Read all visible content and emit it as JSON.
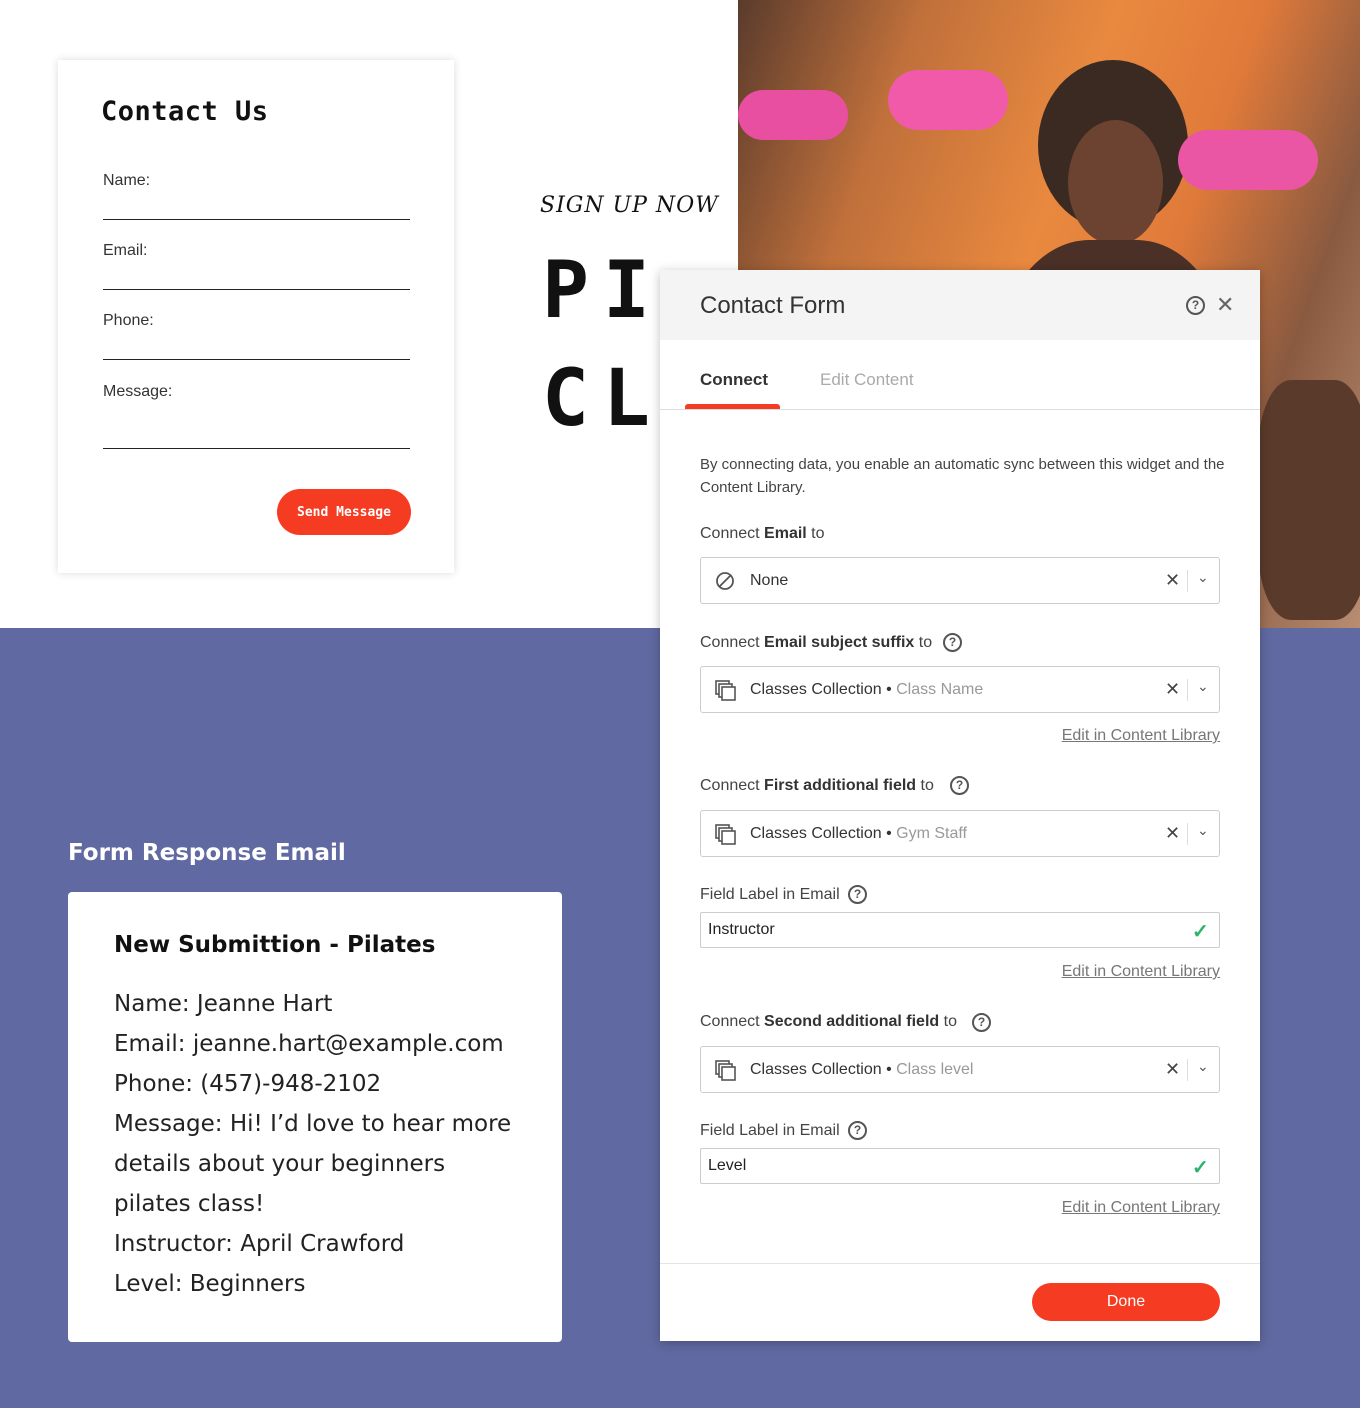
{
  "contact_card": {
    "title": "Contact Us",
    "fields": [
      "Name:",
      "Email:",
      "Phone:",
      "Message:"
    ],
    "send_label": "Send Message"
  },
  "hero": {
    "signup": "SIGN UP NOW",
    "line1": "PI",
    "line2": "CL"
  },
  "email_preview": {
    "section_title": "Form Response Email",
    "heading": "New Submittion - Pilates",
    "lines": [
      "Name: Jeanne Hart",
      "Email: jeanne.hart@example.com",
      "Phone: (457)-948-2102",
      "Message: Hi! I’d love to hear more",
      "details about your beginners",
      "pilates class!",
      "Instructor: April Crawford",
      "Level: Beginners"
    ]
  },
  "dialog": {
    "title": "Contact Form",
    "tabs": {
      "active": "Connect",
      "inactive": "Edit Content"
    },
    "intro": "By connecting data, you enable an automatic sync between this widget and the Content Library.",
    "connect_email": {
      "pre": "Connect ",
      "bold": "Email",
      "post": " to",
      "value": "None"
    },
    "connect_subject": {
      "pre": "Connect ",
      "bold": "Email subject suffix",
      "post": " to",
      "collection": "Classes Collection",
      "field": "Class Name"
    },
    "connect_first": {
      "pre": "Connect ",
      "bold": "First additional field",
      "post": " to",
      "collection": "Classes Collection",
      "field": "Gym Staff"
    },
    "field_label_1": {
      "label": "Field Label in Email",
      "value": "Instructor"
    },
    "connect_second": {
      "pre": "Connect ",
      "bold": "Second additional field",
      "post": " to",
      "collection": "Classes Collection",
      "field": "Class level"
    },
    "field_label_2": {
      "label": "Field Label in Email",
      "value": "Level"
    },
    "edit_link": "Edit in Content Library",
    "done_label": "Done",
    "separator": "•"
  },
  "colors": {
    "accent": "#f53b22",
    "purple": "#6069a1",
    "check": "#2db36b"
  }
}
